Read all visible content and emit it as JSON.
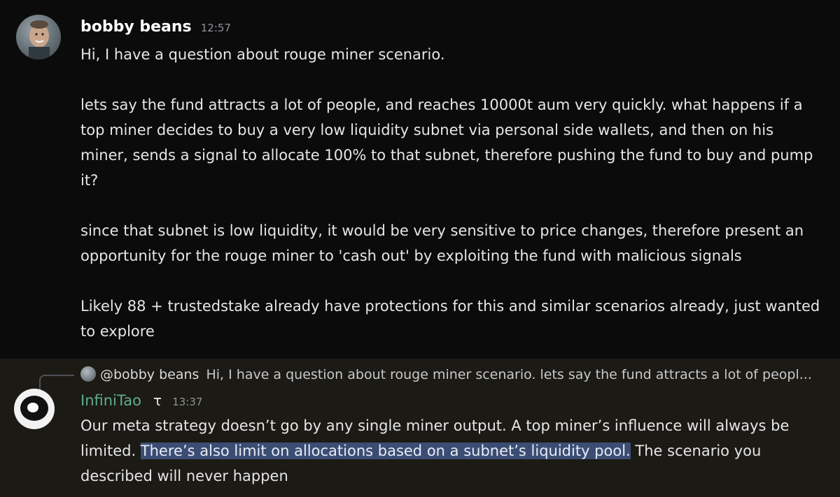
{
  "message1": {
    "author": "bobby beans",
    "time": "12:57",
    "paragraphs": [
      "Hi, I have a question about rouge miner scenario.",
      "lets say the fund attracts a lot of people, and reaches 10000t aum very quickly. what happens if a top miner decides to buy a very low liquidity subnet via personal side wallets, and then on his miner, sends a signal to allocate 100% to that subnet, therefore pushing the fund to buy and pump it?",
      "since that subnet is low liquidity, it would be very sensitive to price changes, therefore present an opportunity for the rouge miner to 'cash out' by exploiting the fund with malicious signals",
      "Likely 88 + trustedstake already have protections for this and similar scenarios already, just wanted to explore"
    ]
  },
  "message2": {
    "reply": {
      "author": "@bobby beans",
      "text": "Hi, I have a question about rouge miner scenario.   lets say the fund attracts a lot of peopl..."
    },
    "author": "InfiniTao",
    "tag_icon_glyph": "τ",
    "time": "13:37",
    "text_before": "Our meta strategy doesn’t go by any single miner output. A top miner’s influence will always be limited. ",
    "text_highlight": "There’s also limit on allocations based on a subnet’s liquidity pool.",
    "text_after": " The scenario you described will never happen",
    "author_color": "#5fae8b",
    "highlight_color": "#3b4d73"
  }
}
